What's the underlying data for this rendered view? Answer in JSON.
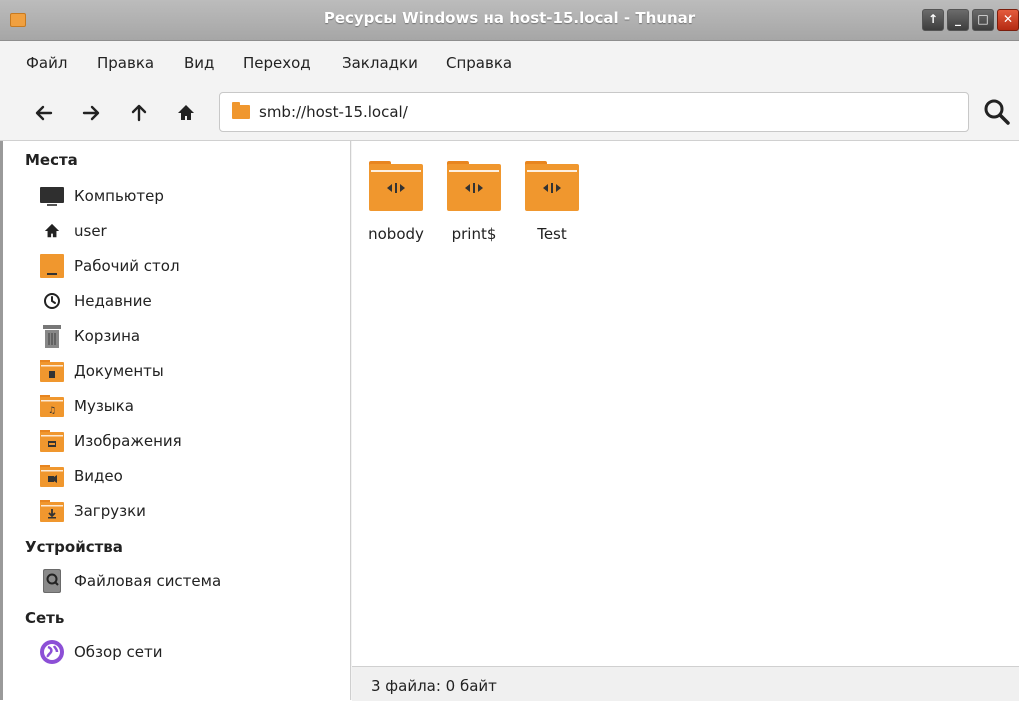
{
  "window": {
    "title": "Ресурсы Windows на host-15.local - Thunar",
    "buttons": [
      "↑",
      "_",
      "□",
      "✕"
    ]
  },
  "menubar": {
    "items": [
      "Файл",
      "Правка",
      "Вид",
      "Переход",
      "Закладки",
      "Справка"
    ]
  },
  "toolbar": {
    "address": "smb://host-15.local/",
    "icons": [
      "arrow-left-icon",
      "arrow-right-icon",
      "arrow-up-icon",
      "home-icon",
      "search-icon"
    ]
  },
  "sidebar": {
    "places_title": "Места",
    "places": [
      {
        "label": "Компьютер",
        "icon": "computer-icon"
      },
      {
        "label": "user",
        "icon": "home-icon"
      },
      {
        "label": "Рабочий стол",
        "icon": "desktop-icon"
      },
      {
        "label": "Недавние",
        "icon": "clock-icon"
      },
      {
        "label": "Корзина",
        "icon": "trash-icon"
      },
      {
        "label": "Документы",
        "icon": "documents-folder-icon"
      },
      {
        "label": "Музыка",
        "icon": "music-folder-icon"
      },
      {
        "label": "Изображения",
        "icon": "pictures-folder-icon"
      },
      {
        "label": "Видео",
        "icon": "video-folder-icon"
      },
      {
        "label": "Загрузки",
        "icon": "downloads-folder-icon"
      }
    ],
    "devices_title": "Устройства",
    "devices": [
      {
        "label": "Файловая система",
        "icon": "drive-icon"
      }
    ],
    "network_title": "Сеть",
    "network": [
      {
        "label": "Обзор сети",
        "icon": "network-icon"
      }
    ]
  },
  "content": {
    "files": [
      {
        "name": "nobody",
        "icon": "network-share-folder-icon"
      },
      {
        "name": "print$",
        "icon": "network-share-folder-icon"
      },
      {
        "name": "Test",
        "icon": "network-share-folder-icon"
      }
    ]
  },
  "status": {
    "text": "3 файла: 0 байт"
  },
  "colors": {
    "folder": "#f0972e",
    "accent": "#8c4fd6"
  }
}
